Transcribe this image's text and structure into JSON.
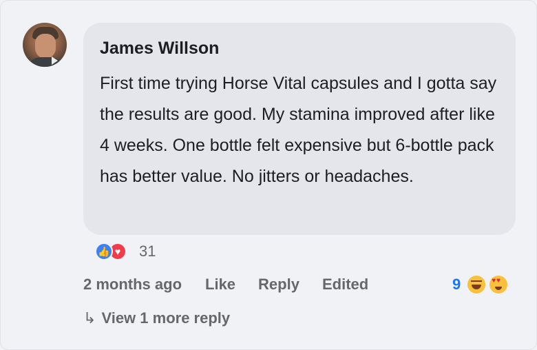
{
  "comment": {
    "author": "James Willson",
    "text": "First time trying Horse Vital capsules and I gotta say the results are good. My stamina improved after like 4 weeks. One bottle felt expensive but 6-bottle pack has better value. No jitters or headaches.",
    "avatar_icon": "user-avatar-photo"
  },
  "reactions": {
    "icons": [
      "like-icon",
      "love-icon"
    ],
    "count": "31"
  },
  "actions": {
    "timestamp": "2 months ago",
    "like_label": "Like",
    "reply_label": "Reply",
    "edited_label": "Edited",
    "emoji_count": "9",
    "emoji_icons": [
      "laughing-tears-emoji",
      "heart-eyes-emoji"
    ]
  },
  "replies": {
    "arrow_icon": "reply-arrow-icon",
    "view_label": "View 1 more reply"
  },
  "colors": {
    "background": "#f0f2f5",
    "bubble": "#e4e6eb",
    "secondary_text": "#65676b",
    "accent": "#1877f2"
  }
}
